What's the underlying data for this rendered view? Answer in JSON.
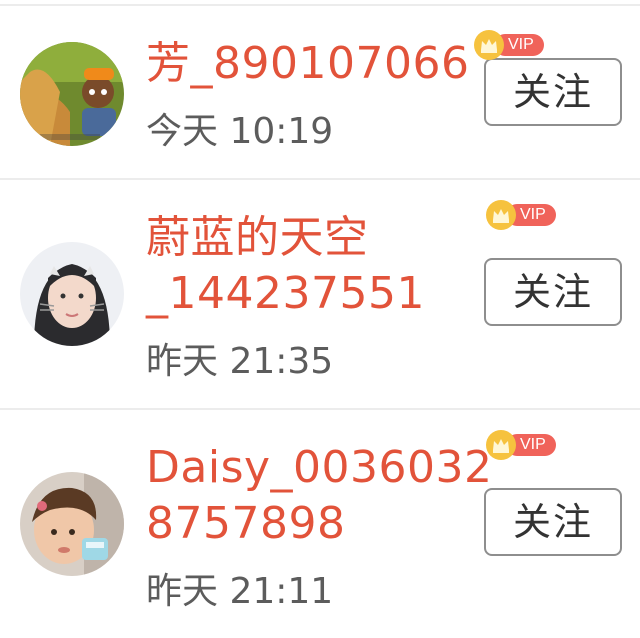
{
  "users": [
    {
      "username": "芳_890107066",
      "time": "今天 10:19",
      "vip_label": "VIP",
      "follow_label": "关注"
    },
    {
      "username": "蔚蓝的天空\n_144237551",
      "time": "昨天 21:35",
      "vip_label": "VIP",
      "follow_label": "关注"
    },
    {
      "username": "Daisy_0036032\n8757898",
      "time": "昨天 21:11",
      "vip_label": "VIP",
      "follow_label": "关注"
    }
  ],
  "colors": {
    "username": "#e2533a",
    "time": "#5c5c5c",
    "vip_pill": "#f0635a",
    "vip_crown": "#f6c23e",
    "button_border": "#8e8e8e",
    "divider": "#ececec"
  },
  "icons": {
    "vip_badge": "crown-icon"
  }
}
